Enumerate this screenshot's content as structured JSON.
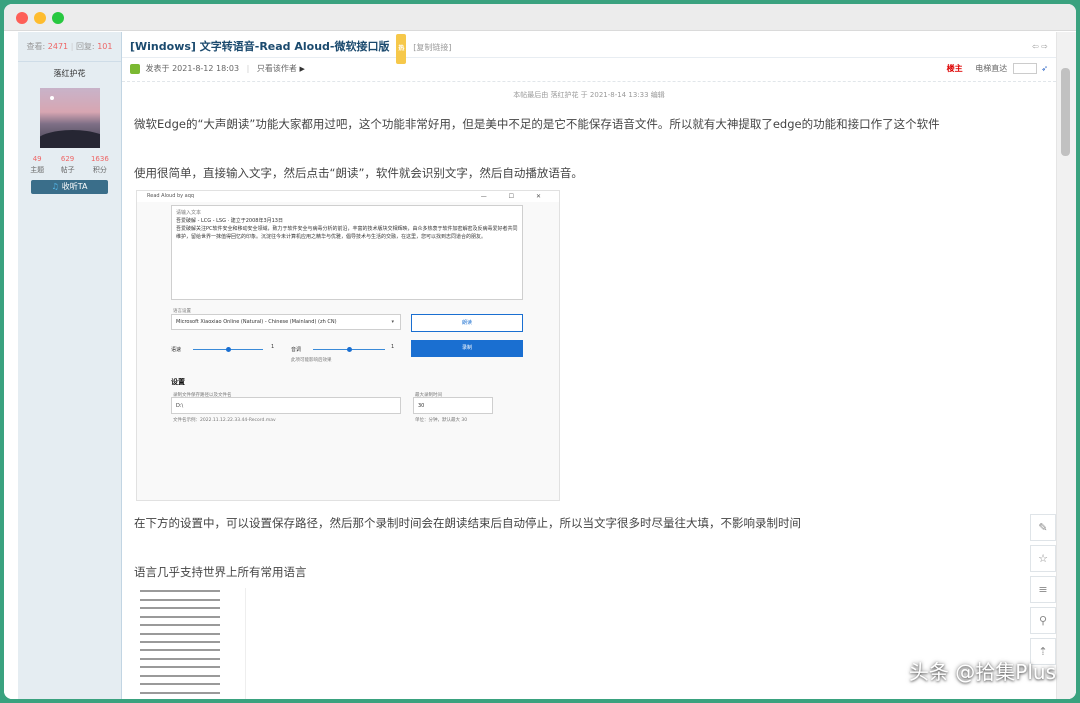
{
  "sidebar": {
    "views_label": "查看:",
    "views": "2471",
    "replies_label": "回复:",
    "replies": "101",
    "author_name": "落红护花",
    "stats": [
      {
        "value": "49",
        "label": "主题"
      },
      {
        "value": "629",
        "label": "帖子"
      },
      {
        "value": "1636",
        "label": "积分"
      }
    ],
    "follow_label": "收听TA"
  },
  "post": {
    "title": "[Windows] 文字转语音-Read Aloud-微软接口版",
    "badge": "热",
    "copy_link": "[复制链接]",
    "posted": "发表于 2021-8-12 18:03",
    "only_author": "只看该作者",
    "floor": "楼主",
    "jump_label": "电梯直达",
    "edited": "本帖最后由 落红护花 于 2021-8-14 13:33 编辑",
    "p1": "微软Edge的“大声朗读”功能大家都用过吧，这个功能非常好用，但是美中不足的是它不能保存语音文件。所以就有大神提取了edge的功能和接口作了这个软件",
    "p2": "使用很简单，直接输入文字，然后点击“朗读”，软件就会识别文字，然后自动播放语音。",
    "p3": "在下方的设置中，可以设置保存路径，然后那个录制时间会在朗读结束后自动停止，所以当文字很多时尽量往大填，不影响录制时间",
    "p4": "语言几乎支持世界上所有常用语言"
  },
  "screenshot": {
    "window_title": "Read Aloud by aqq",
    "window_controls": "—  ☐  ✕",
    "input_label": "请输入文本",
    "text_line1": "吾爱破解 - LCG - LSG · 建立于2008年3月13日",
    "text_line2": "吾爱破解关注PC软件安全和移动安全领域，致力于软件安全与病毒分析的前沿，丰富的技术版块交相辉映，由众多热衷于软件加密解密及反病毒爱好者共同维护，留给世界一抹值得回忆的印象。沉淀往今未计算机应用之精华与优雅，倡导技术与生活的交融，在这里，您可以找到志同道合的朋友。",
    "voice_label": "语言设置",
    "voice": "Microsoft Xiaoxiao Online (Natural) - Chinese (Mainland) (zh CN)",
    "read_btn": "朗读",
    "record_btn": "录制",
    "speed_label": "语速",
    "speed_value": "1",
    "pitch_label": "音调",
    "pitch_value": "1",
    "hint": "此项可能影响后效果",
    "settings": "设置",
    "path_label": "录制文件保存路径以及文件名",
    "path_value": "D:\\",
    "path_hint": "文件名示例：2022.11.12.22.33.44-Record.mav",
    "time_label": "最大录制时间",
    "time_value": "30",
    "time_hint": "单位：分钟，默认最大 30"
  },
  "icons": {
    "edit": "✎",
    "star": "☆",
    "list": "≡",
    "search": "⚲",
    "top": "⇡"
  },
  "watermark": "头条 @拾集Plus"
}
